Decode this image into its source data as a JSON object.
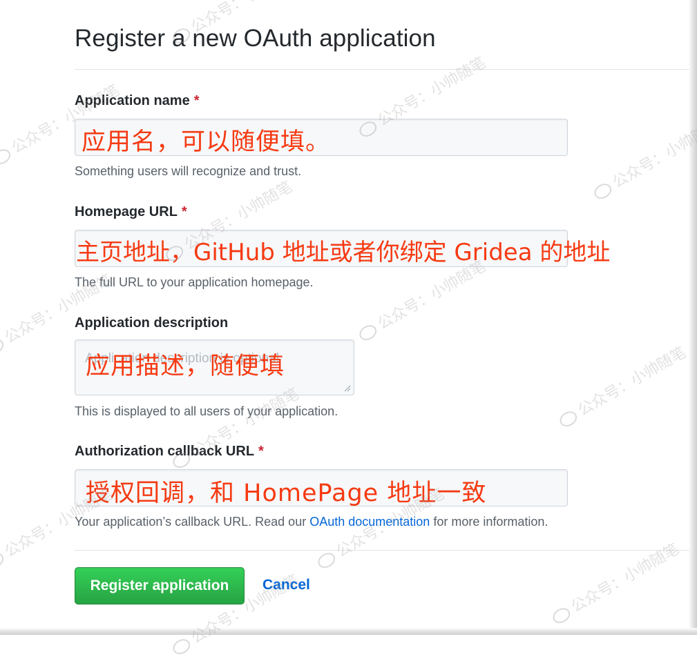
{
  "form": {
    "title": "Register a new OAuth application",
    "required_mark": "*",
    "fields": {
      "app_name": {
        "label": "Application name",
        "annotation": "应用名，可以随便填。",
        "note": "Something users will recognize and trust."
      },
      "homepage_url": {
        "label": "Homepage URL",
        "annotation": "主页地址，GitHub 地址或者你绑定 Gridea 的地址",
        "note": "The full URL to your application homepage."
      },
      "description": {
        "label": "Application description",
        "placeholder": "Application description is optional",
        "annotation": "应用描述，随便填",
        "note": "This is displayed to all users of your application."
      },
      "callback_url": {
        "label": "Authorization callback URL",
        "annotation": "授权回调，和 HomePage 地址一致",
        "note_before": "Your application’s callback URL. Read our ",
        "note_link": "OAuth documentation",
        "note_after": " for more information."
      }
    },
    "buttons": {
      "register": "Register application",
      "cancel": "Cancel"
    }
  },
  "watermark": {
    "text": "公众号：小帅随笔"
  },
  "colors": {
    "annotation": "#f63a12",
    "required": "#cb2431",
    "link": "#0366d6",
    "primary_button": "#28a745"
  }
}
